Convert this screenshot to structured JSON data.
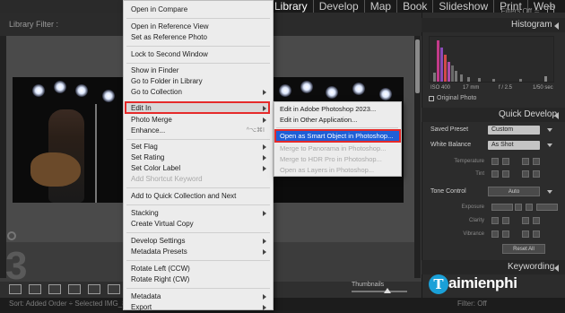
{
  "modules": [
    "Library",
    "Develop",
    "Map",
    "Book",
    "Slideshow",
    "Print",
    "Web"
  ],
  "filter_bar": {
    "title": "Library Filter :",
    "filters_off": "Filters Off ≑"
  },
  "grid": {
    "cell_number": "3"
  },
  "toolbar": {
    "thumbnails_label": "Thumbnails"
  },
  "status": {
    "left": "Sort: Added Order ÷   Selected  IMG_8155.CR3 ▾",
    "right": "Filter: Off"
  },
  "menu": {
    "items": [
      {
        "label": "Open in Compare"
      },
      {
        "label": "Open in Reference View"
      },
      {
        "label": "Set as Reference Photo"
      },
      {
        "label": "Lock to Second Window"
      },
      {
        "label": "Show in Finder"
      },
      {
        "label": "Go to Folder in Library"
      },
      {
        "label": "Go to Collection"
      },
      {
        "label": "Edit In"
      },
      {
        "label": "Photo Merge"
      },
      {
        "label": "Enhance...",
        "shortcut": "^⌥⌘I"
      },
      {
        "label": "Set Flag"
      },
      {
        "label": "Set Rating"
      },
      {
        "label": "Set Color Label"
      },
      {
        "label": "Add Shortcut Keyword"
      },
      {
        "label": "Add to Quick Collection and Next"
      },
      {
        "label": "Stacking"
      },
      {
        "label": "Create Virtual Copy"
      },
      {
        "label": "Develop Settings"
      },
      {
        "label": "Metadata Presets"
      },
      {
        "label": "Rotate Left (CCW)"
      },
      {
        "label": "Rotate Right (CW)"
      },
      {
        "label": "Metadata"
      },
      {
        "label": "Export"
      }
    ]
  },
  "submenu": {
    "items": [
      {
        "label": "Edit in Adobe Photoshop 2023..."
      },
      {
        "label": "Edit in Other Application..."
      },
      {
        "label": "Open as Smart Object in Photoshop..."
      },
      {
        "label": "Merge to Panorama in Photoshop..."
      },
      {
        "label": "Merge to HDR Pro in Photoshop..."
      },
      {
        "label": "Open as Layers in Photoshop..."
      }
    ]
  },
  "right_panel": {
    "histogram_title": "Histogram",
    "iso": "ISO 400",
    "focal": "17 mm",
    "aperture": "f / 2.5",
    "shutter": "1/50 sec",
    "original_photo": "Original Photo",
    "quick_develop_title": "Quick Develop",
    "saved_preset_label": "Saved Preset",
    "saved_preset_value": "Custom",
    "white_balance_label": "White Balance",
    "white_balance_value": "As Shot",
    "temperature": "Temperature",
    "tint": "Tint",
    "tone_control_label": "Tone Control",
    "auto_label": "Auto",
    "exposure": "Exposure",
    "clarity": "Clarity",
    "vibrance": "Vibrance",
    "reset_all": "Reset All",
    "keywording_title": "Keywording"
  },
  "watermark": {
    "logo_letter": "T",
    "text": "aimienphi"
  }
}
